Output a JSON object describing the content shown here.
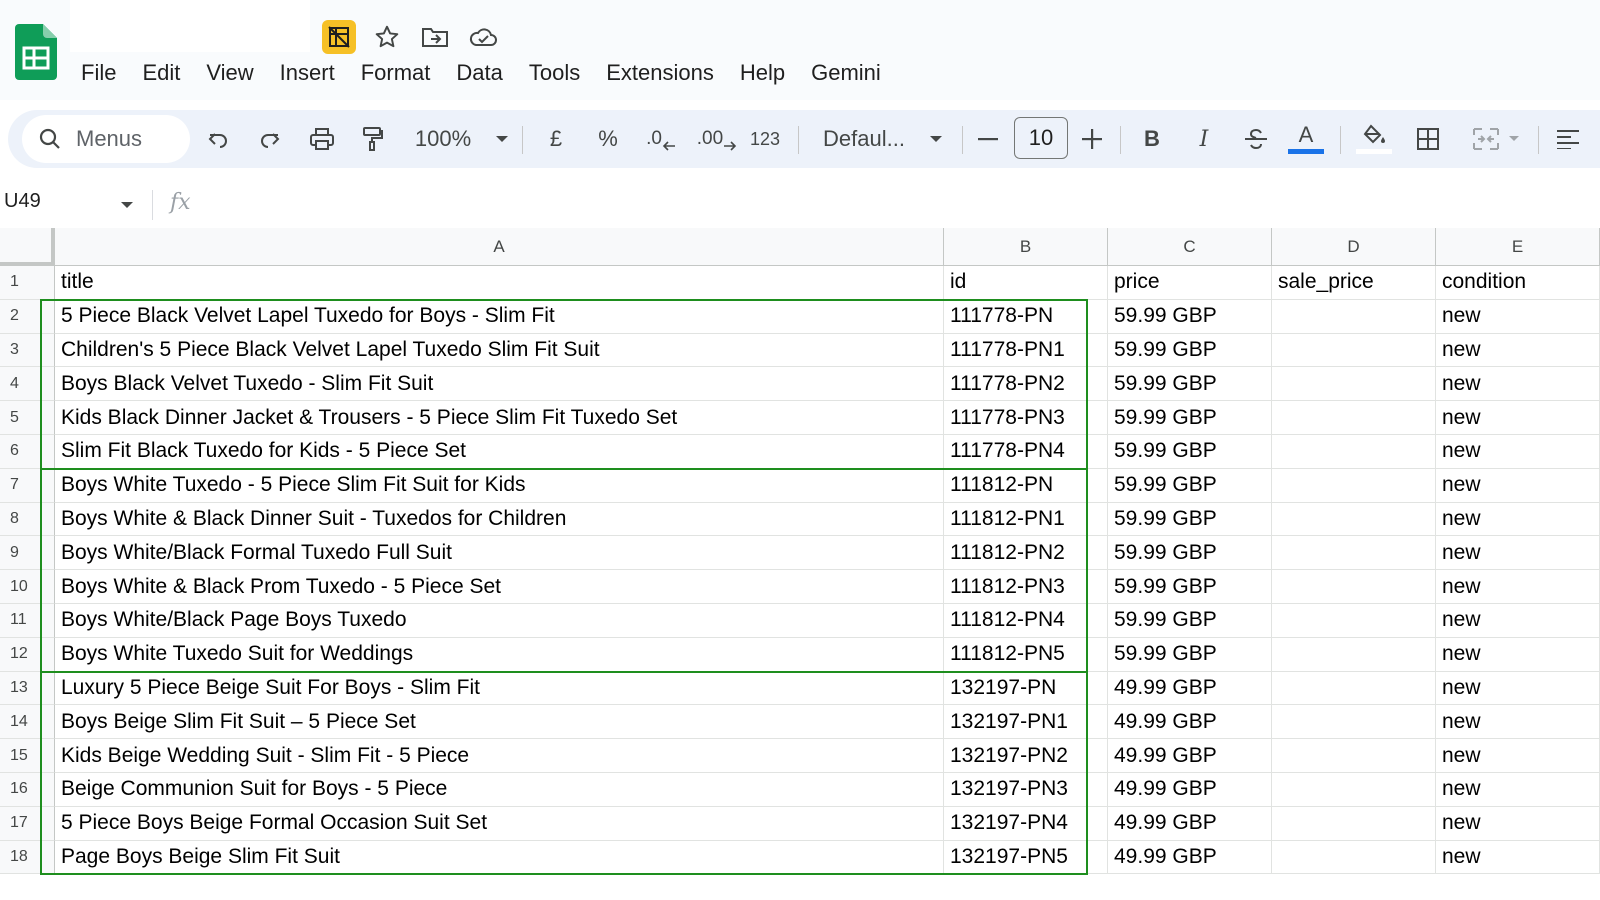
{
  "app": {
    "menu": [
      "File",
      "Edit",
      "View",
      "Insert",
      "Format",
      "Data",
      "Tools",
      "Extensions",
      "Help",
      "Gemini"
    ],
    "title_icons": [
      "hide-gridlines-icon",
      "star-icon",
      "move-to-folder-icon",
      "cloud-status-icon"
    ]
  },
  "toolbar": {
    "search_label": "Menus",
    "zoom": "100%",
    "currency": "£",
    "percent": "%",
    "decrease_decimal": ".0",
    "increase_decimal": ".00",
    "number_format": "123",
    "font": "Defaul...",
    "font_size": "10",
    "bold": "B",
    "italic": "I",
    "text_color_letter": "A",
    "text_color": "#1a73e8"
  },
  "formula_bar": {
    "cell_ref": "U49",
    "fx": "fx"
  },
  "grid": {
    "columns": [
      "A",
      "B",
      "C",
      "D",
      "E"
    ],
    "row_numbers": [
      "1",
      "2",
      "3",
      "4",
      "5",
      "6",
      "7",
      "8",
      "9",
      "10",
      "11",
      "12",
      "13",
      "14",
      "15",
      "16",
      "17",
      "18"
    ],
    "rows": [
      [
        "title",
        "id",
        "price",
        "sale_price",
        "condition"
      ],
      [
        "5 Piece Black Velvet Lapel Tuxedo for Boys - Slim Fit",
        "111778-PN",
        "59.99 GBP",
        "",
        "new"
      ],
      [
        "Children's 5 Piece Black Velvet Lapel Tuxedo Slim Fit Suit",
        "111778-PN1",
        "59.99 GBP",
        "",
        "new"
      ],
      [
        "Boys Black Velvet Tuxedo - Slim Fit Suit",
        "111778-PN2",
        "59.99 GBP",
        "",
        "new"
      ],
      [
        "Kids Black Dinner Jacket & Trousers - 5 Piece Slim Fit Tuxedo Set",
        "111778-PN3",
        "59.99 GBP",
        "",
        "new"
      ],
      [
        "Slim Fit Black Tuxedo for Kids - 5 Piece Set",
        "111778-PN4",
        "59.99 GBP",
        "",
        "new"
      ],
      [
        "Boys White Tuxedo - 5 Piece Slim Fit Suit for Kids",
        "111812-PN",
        "59.99 GBP",
        "",
        "new"
      ],
      [
        "Boys White & Black Dinner Suit - Tuxedos for Children",
        "111812-PN1",
        "59.99 GBP",
        "",
        "new"
      ],
      [
        "Boys White/Black Formal Tuxedo Full Suit",
        "111812-PN2",
        "59.99 GBP",
        "",
        "new"
      ],
      [
        "Boys White & Black Prom Tuxedo - 5 Piece Set",
        "111812-PN3",
        "59.99 GBP",
        "",
        "new"
      ],
      [
        "Boys White/Black Page Boys Tuxedo",
        "111812-PN4",
        "59.99 GBP",
        "",
        "new"
      ],
      [
        "Boys White Tuxedo Suit for Weddings",
        "111812-PN5",
        "59.99 GBP",
        "",
        "new"
      ],
      [
        "Luxury 5 Piece Beige Suit For Boys - Slim Fit",
        "132197-PN",
        "49.99 GBP",
        "",
        "new"
      ],
      [
        "Boys Beige Slim Fit Suit – 5 Piece Set",
        "132197-PN1",
        "49.99 GBP",
        "",
        "new"
      ],
      [
        "Kids Beige Wedding Suit - Slim Fit - 5 Piece",
        "132197-PN2",
        "49.99 GBP",
        "",
        "new"
      ],
      [
        "Beige Communion Suit for Boys - 5 Piece",
        "132197-PN3",
        "49.99 GBP",
        "",
        "new"
      ],
      [
        "5 Piece Boys Beige Formal Occasion Suit Set",
        "132197-PN4",
        "49.99 GBP",
        "",
        "new"
      ],
      [
        "Page Boys Beige Slim Fit Suit",
        "132197-PN5",
        "49.99 GBP",
        "",
        "new"
      ]
    ],
    "group_box_color": "#1e8e1e"
  }
}
